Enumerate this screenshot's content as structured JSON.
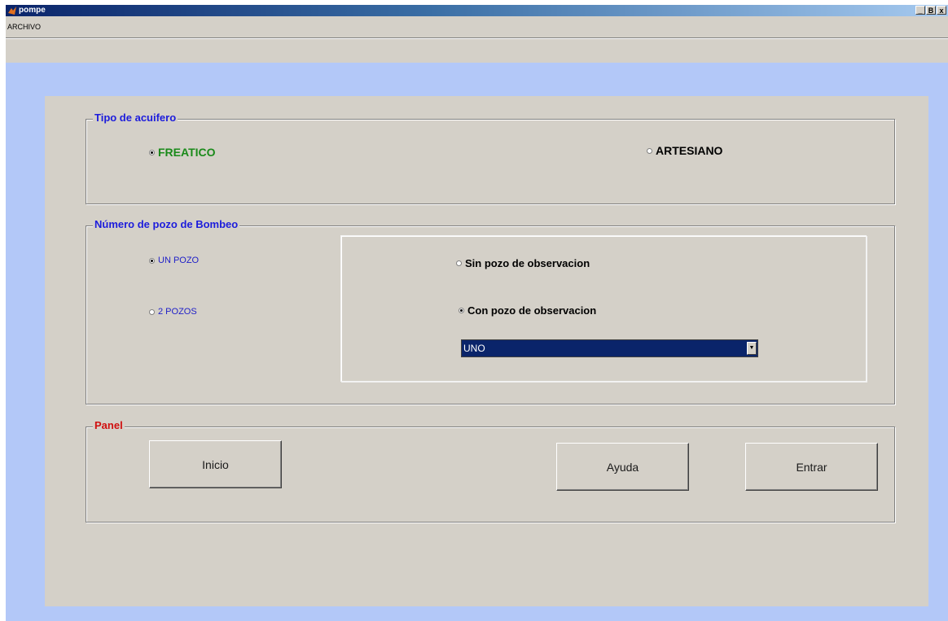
{
  "window": {
    "title": "pompe",
    "buttons": {
      "minimize": "_",
      "maximize": "B",
      "close": "x"
    }
  },
  "menu": {
    "items": [
      "ARCHIVO"
    ]
  },
  "colors": {
    "group_title": "#1c1cdc",
    "freatico": "#1a8a1a",
    "panel_title": "#d01010",
    "radio_small": "#2020c8",
    "background_blue": "#b3c8f8",
    "select_bg": "#0a246a"
  },
  "tipo_acuifero": {
    "title": "Tipo de acuifero",
    "freatico": {
      "label": "FREATICO",
      "selected": true
    },
    "artesiano": {
      "label": "ARTESIANO",
      "selected": false
    }
  },
  "numero_pozo": {
    "title": "Número de pozo de Bombeo",
    "un_pozo": {
      "label": "UN POZO",
      "selected": true
    },
    "dos_pozos": {
      "label": "2 POZOS",
      "selected": false
    },
    "sin_pozo": {
      "label": "Sin pozo de observacion",
      "selected": false
    },
    "con_pozo": {
      "label": "Con pozo de observacion",
      "selected": true
    },
    "observacion_select": {
      "value": "UNO"
    }
  },
  "panel": {
    "title": "Panel",
    "inicio": "Inicio",
    "ayuda": "Ayuda",
    "entrar": "Entrar"
  }
}
